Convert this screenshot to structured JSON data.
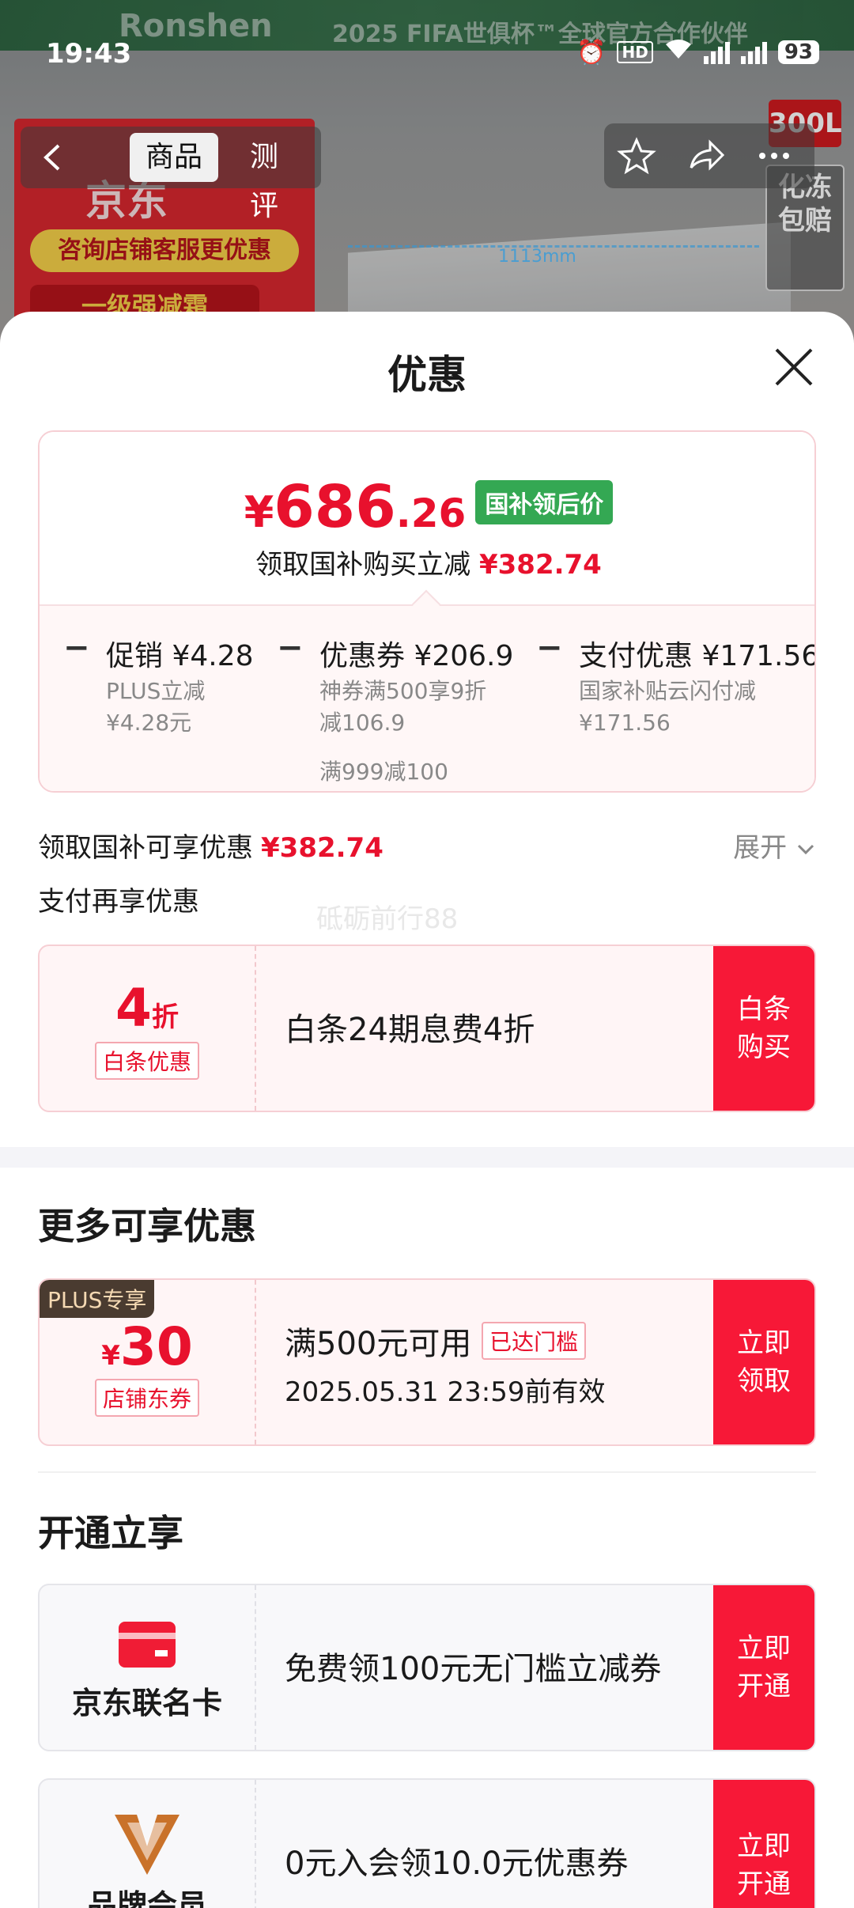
{
  "background": {
    "banner_brand": "Ronshen",
    "banner_text": "2025 FIFA世俱杯™全球官方合作伙伴",
    "poster_brand": "京东",
    "poster_line1": "咨询店铺客服更优惠",
    "poster_line2": "一级强减霜",
    "dimension_label": "1113mm",
    "badge_capacity": "300L",
    "badge_promise": "化冻包赔"
  },
  "status_bar": {
    "time": "19:43",
    "hd": "HD",
    "battery": "93"
  },
  "nav": {
    "tabs": [
      {
        "label": "商品",
        "active": true
      },
      {
        "label": "测评",
        "active": false
      }
    ],
    "icons": [
      "back-icon",
      "star-icon",
      "share-icon",
      "more-icon"
    ]
  },
  "sheet": {
    "title": "优惠",
    "price": {
      "currency": "¥",
      "integer": "686",
      "decimal": ".26",
      "tag": "国补领后价"
    },
    "price_sub": {
      "text": "领取国补购买立减",
      "amount": "¥382.74"
    },
    "discounts": [
      {
        "head": "促销 ¥4.28",
        "desc_line1": "PLUS立减",
        "desc_line2": "¥4.28元",
        "extra": ""
      },
      {
        "head": "优惠券 ¥206.9",
        "desc_line1": "神券满500享9折",
        "desc_line2": "减106.9",
        "extra": "满999减100"
      },
      {
        "head": "支付优惠 ¥171.56",
        "desc_line1": "国家补贴云闪付减",
        "desc_line2": "¥171.56",
        "extra": ""
      }
    ],
    "subsidy": {
      "text": "领取国补可享优惠",
      "amount": "¥382.74",
      "expand": "展开"
    },
    "pay_title": "支付再享优惠",
    "watermark": "砥砺前行88",
    "baitiao": {
      "value": "4",
      "unit": "折",
      "label": "白条优惠",
      "desc": "白条24期息费4折",
      "cta": "白条购买"
    },
    "more_title": "更多可享优惠",
    "store_coupon": {
      "badge": "PLUS专享",
      "currency": "¥",
      "amount": "30",
      "label": "店铺东券",
      "condition": "满500元可用",
      "status": "已达门槛",
      "expiry": "2025.05.31 23:59前有效",
      "cta": "立即领取"
    },
    "open_title": "开通立享",
    "jd_card": {
      "label": "京东联名卡",
      "desc": "免费领100元无门槛立减券",
      "cta": "立即开通"
    },
    "brand_member": {
      "label": "品牌会员",
      "desc": "0元入会领10.0元优惠券",
      "cta": "立即开通"
    }
  },
  "colors": {
    "accent_red": "#e8112d",
    "cta_red": "#f71837",
    "green_tag": "#34a853"
  }
}
